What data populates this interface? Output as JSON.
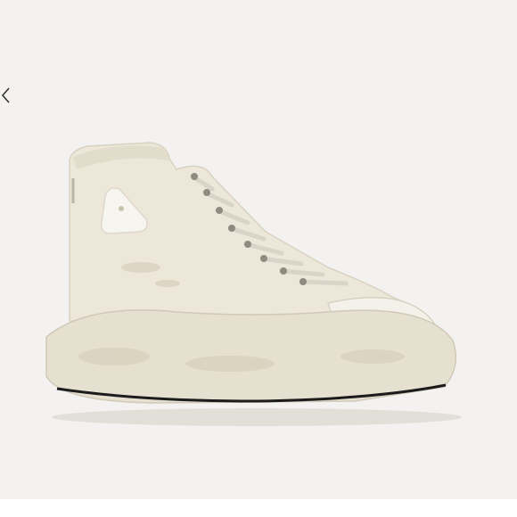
{
  "viewer": {
    "background": "#f3f2f0",
    "controls": {
      "prev_icon": "chevron-left-icon"
    },
    "image": {
      "subject_icon": "high-top-sneaker-image",
      "colors": {
        "canvas": "#ece7d9",
        "sole": "#e6e0d0",
        "sole_stripe": "#1c1c1c",
        "laces": "#d8d4c8",
        "patch": "#f7f5ef"
      }
    }
  }
}
